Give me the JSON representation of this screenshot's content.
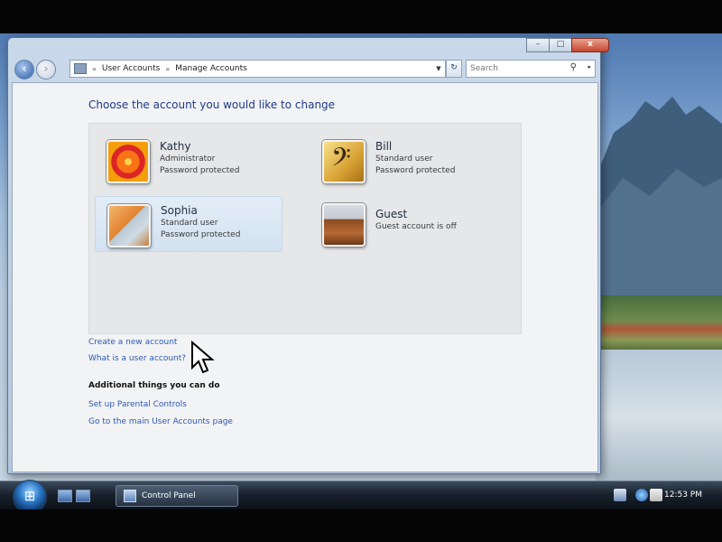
{
  "window": {
    "title_buttons": [
      "–",
      "□",
      "x"
    ],
    "nav": {
      "back_icon": "back-arrow-icon",
      "forward_icon": "forward-arrow-icon"
    },
    "address": {
      "crumbs": [
        "User Accounts",
        "Manage Accounts"
      ],
      "separator": "»"
    },
    "search": {
      "placeholder": "Search"
    }
  },
  "main": {
    "title": "Choose the account you would like to change",
    "accounts": [
      {
        "name": "Kathy",
        "type": "Administrator",
        "status": "Password protected",
        "picture": "flower"
      },
      {
        "name": "Bill",
        "type": "Standard user",
        "status": "Password protected",
        "picture": "bass-clef"
      },
      {
        "name": "Sophia",
        "type": "Standard user",
        "status": "Password protected",
        "picture": "autumn-leaf"
      },
      {
        "name": "Guest",
        "type": "Guest account is off",
        "status": "",
        "picture": "briefcase"
      }
    ],
    "links": {
      "create": "Create a new account",
      "what_is": "What is a user account?"
    },
    "additional": {
      "heading": "Additional things you can do",
      "parental": "Set up Parental Controls",
      "main_page": "Go to the main User Accounts page"
    }
  },
  "taskbar": {
    "start_icon": "windows-orb-icon",
    "task": "Control Panel",
    "clock": "12:53 PM"
  },
  "colors": {
    "link": "#2c58b3",
    "title": "#1e3a8a"
  }
}
